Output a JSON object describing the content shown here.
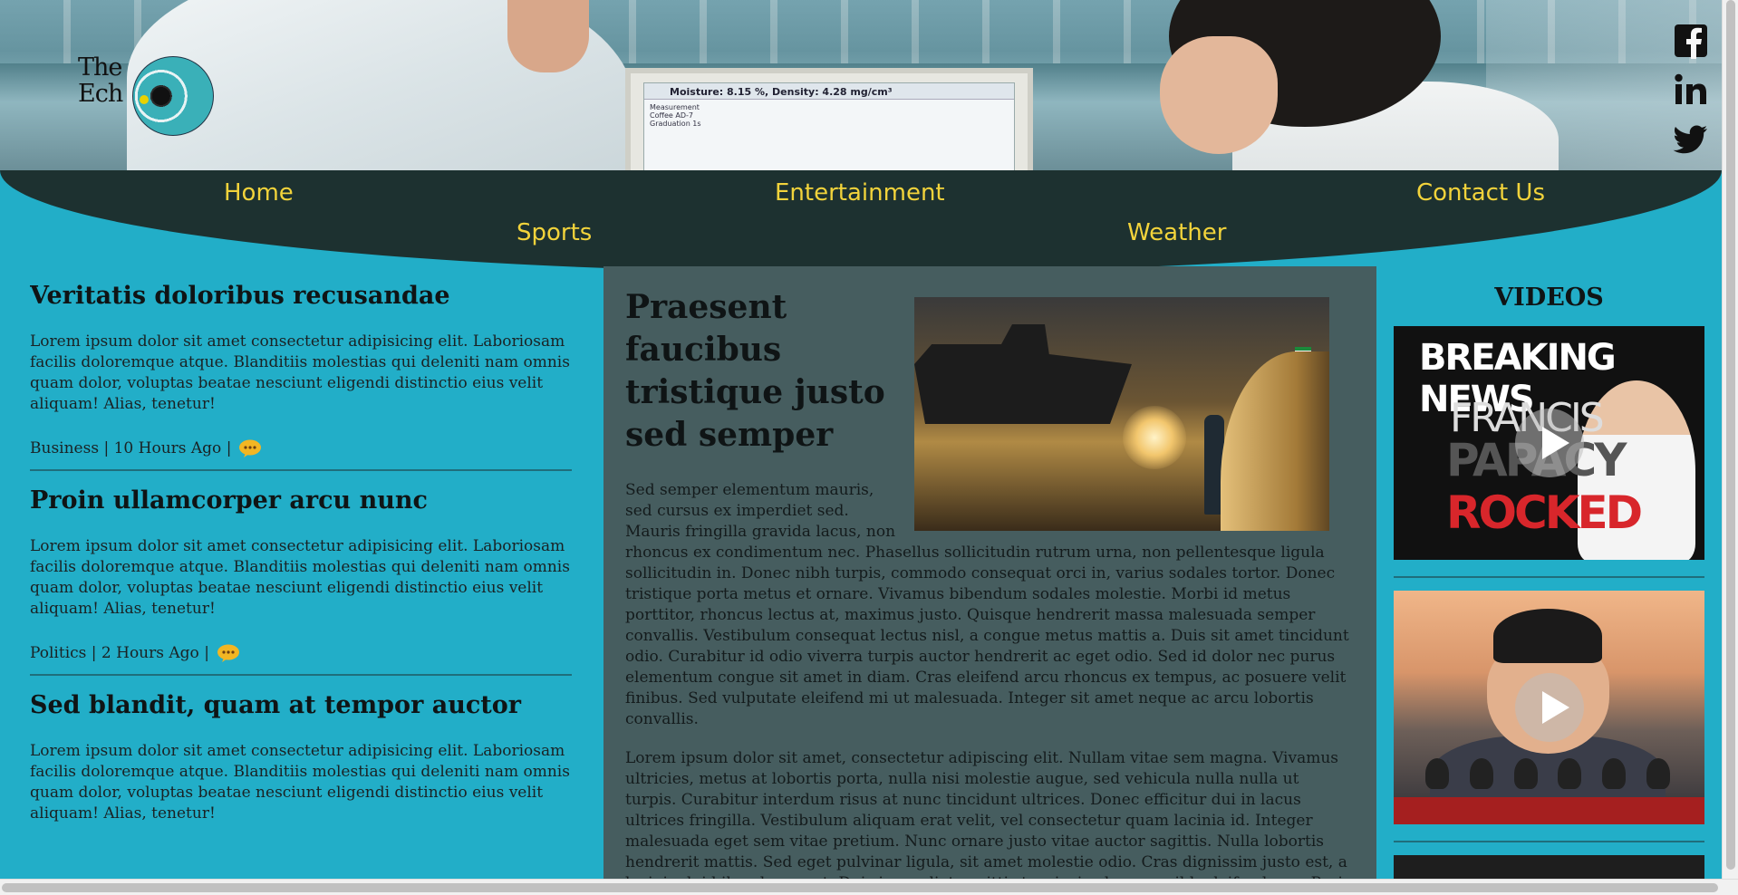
{
  "logo": {
    "line1": "The",
    "line2": "Ech"
  },
  "social": [
    {
      "icon": "facebook-icon"
    },
    {
      "icon": "linkedin-icon"
    },
    {
      "icon": "twitter-icon"
    }
  ],
  "hero": {
    "monitor_readout": "Moisture: 8.15 %, Density: 4.28 mg/cm³",
    "row1": "Measurement",
    "row2": "Coffee AD-7",
    "row3": "Graduation 1s"
  },
  "nav": {
    "home": "Home",
    "entertainment": "Entertainment",
    "contact": "Contact Us",
    "sports": "Sports",
    "weather": "Weather"
  },
  "left_articles": [
    {
      "title": "Veritatis doloribus recusandae",
      "body": "Lorem ipsum dolor sit amet consectetur adipisicing elit. Laboriosam facilis doloremque atque. Blanditiis molestias qui deleniti nam omnis quam dolor, voluptas beatae nesciunt eligendi distinctio eius velit aliquam! Alias, tenetur!",
      "meta": "Business | 10 Hours Ago |"
    },
    {
      "title": "Proin ullamcorper arcu nunc",
      "body": "Lorem ipsum dolor sit amet consectetur adipisicing elit. Laboriosam facilis doloremque atque. Blanditiis molestias qui deleniti nam omnis quam dolor, voluptas beatae nesciunt eligendi distinctio eius velit aliquam! Alias, tenetur!",
      "meta": "Politics | 2 Hours Ago |"
    },
    {
      "title": "Sed blandit, quam at tempor auctor",
      "body": "Lorem ipsum dolor sit amet consectetur adipisicing elit. Laboriosam facilis doloremque atque. Blanditiis molestias qui deleniti nam omnis quam dolor, voluptas beatae nesciunt eligendi distinctio eius velit aliquam! Alias, tenetur!",
      "meta": ""
    }
  ],
  "main_article": {
    "title": "Praesent faucibus tristique justo sed semper",
    "para1": "Sed semper elementum mauris, sed cursus ex imperdiet sed. Mauris fringilla gravida lacus, non rhoncus ex condimentum nec. Phasellus sollicitudin rutrum urna, non pellentesque ligula sollicitudin in. Donec nibh turpis, commodo consequat orci in, varius sodales tortor. Donec tristique porta metus et ornare. Vivamus bibendum sodales molestie. Morbi id metus porttitor, rhoncus lectus at, maximus justo. Quisque hendrerit massa malesuada semper convallis. Vestibulum consequat lectus nisl, a congue metus mattis a. Duis sit amet tincidunt odio. Curabitur id odio viverra turpis auctor hendrerit ac eget odio. Sed id dolor nec purus elementum congue sit amet in diam. Cras eleifend arcu rhoncus ex tempus, ac posuere velit finibus. Sed vulputate eleifend mi ut malesuada. Integer sit amet neque ac arcu lobortis convallis.",
    "para2": "Lorem ipsum dolor sit amet, consectetur adipiscing elit. Nullam vitae sem magna. Vivamus ultricies, metus at lobortis porta, nulla nisi molestie augue, sed vehicula nulla nulla ut turpis. Curabitur interdum risus at nunc tincidunt ultrices. Donec efficitur dui in lacus ultrices fringilla. Vestibulum aliquam erat velit, vel consectetur quam lacinia id. Integer malesuada eget sem vitae pretium. Nunc ornare justo vitae auctor sagittis. Nulla lobortis hendrerit mattis. Sed eget pulvinar ligula, sit amet molestie odio. Cras dignissim justo est, a lacinia dui bibendum eget. Duis imperdiet sagittis turpis, in rhoncus nibh eleifend non. Proin eget tincidunt turpis. Mauris vehicula diam vel"
  },
  "videos": {
    "title": "VIDEOS",
    "v1_line1": "BREAKING NEWS",
    "v1_line2": "FRANCIS",
    "v1_line3": "PAPACY",
    "v1_line4": "ROCKED"
  }
}
